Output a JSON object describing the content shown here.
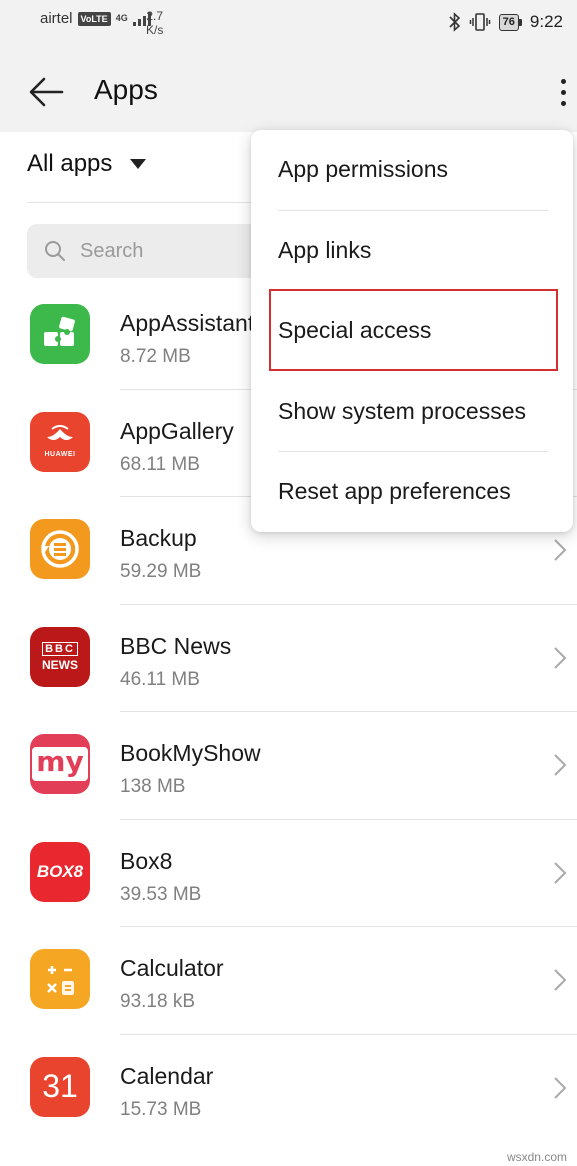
{
  "status_bar": {
    "carrier": "airtel",
    "volte": "VoLTE",
    "network": "4G",
    "speed_value": "2.7",
    "speed_unit": "K/s",
    "battery": "76",
    "time": "9:22"
  },
  "header": {
    "title": "Apps"
  },
  "filter": {
    "label": "All apps"
  },
  "search": {
    "placeholder": "Search"
  },
  "apps": [
    {
      "name": "AppAssistant",
      "size": "8.72 MB",
      "icon": "puzzle-icon",
      "color": "#3cb94a"
    },
    {
      "name": "AppGallery",
      "size": "68.11 MB",
      "icon": "huawei-bag-icon",
      "color": "#e8442e"
    },
    {
      "name": "Backup",
      "size": "59.29 MB",
      "icon": "backup-icon",
      "color": "#f39a1e"
    },
    {
      "name": "BBC News",
      "size": "46.11 MB",
      "icon": "bbc-news-icon",
      "color": "#bb1919"
    },
    {
      "name": "BookMyShow",
      "size": "138 MB",
      "icon": "my-icon",
      "color": "#e23e57"
    },
    {
      "name": "Box8",
      "size": "39.53 MB",
      "icon": "box8-icon",
      "color": "#e8282e"
    },
    {
      "name": "Calculator",
      "size": "93.18 kB",
      "icon": "calculator-icon",
      "color": "#f5a623"
    },
    {
      "name": "Calendar",
      "size": "15.73 MB",
      "icon": "calendar-icon",
      "color": "#e8442e"
    }
  ],
  "icon_text": {
    "huawei": "HUAWEI",
    "bbc": "BBC",
    "news": "NEWS",
    "my": "my",
    "box8": "BOX8",
    "calendar_day": "31"
  },
  "menu": {
    "items": [
      "App permissions",
      "App links",
      "Special access",
      "Show system processes",
      "Reset app preferences"
    ],
    "highlighted": "Special access"
  },
  "watermark": "wsxdn.com",
  "colors": {
    "highlight_border": "#d32f2f",
    "background": "#f2f2f2"
  }
}
